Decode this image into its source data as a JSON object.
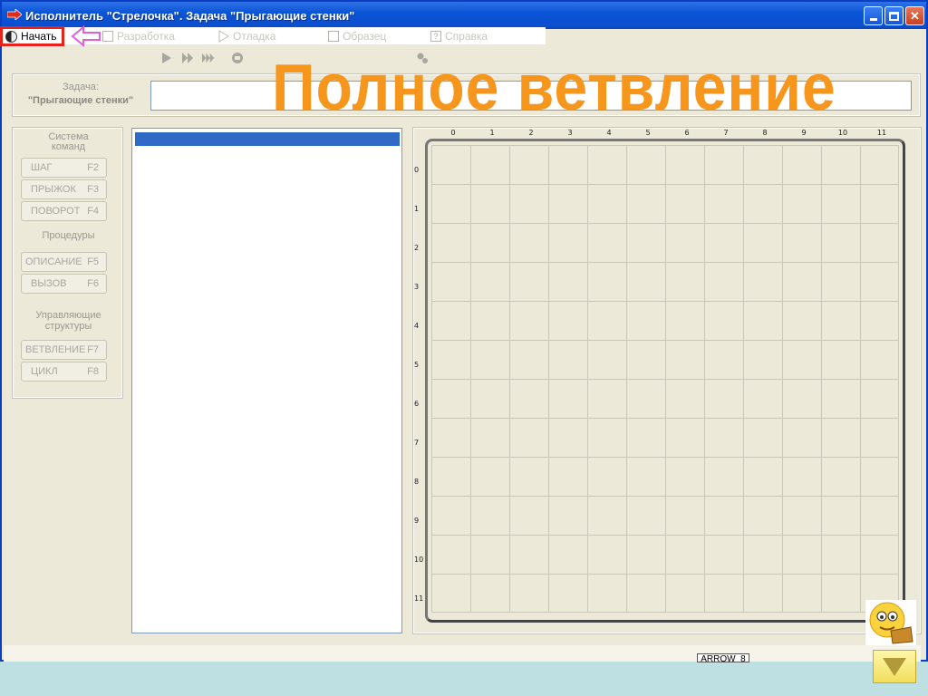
{
  "window": {
    "title": "Исполнитель \"Стрелочка\".  Задача  \"Прыгающие стенки\"",
    "controls": [
      "minimize",
      "maximize",
      "close"
    ]
  },
  "menu": {
    "start_label": "Начать",
    "items": [
      {
        "label": "Разработка",
        "icon": "document-icon"
      },
      {
        "label": "Отладка",
        "icon": "play-outline-icon"
      },
      {
        "label": "Образец",
        "icon": "sample-icon"
      },
      {
        "label": "Справка",
        "icon": "help-icon"
      }
    ]
  },
  "toolbar": {
    "icons": [
      "run-icon",
      "step-run-icon",
      "fast-run-icon",
      "stop-icon",
      "settings-icon"
    ]
  },
  "task": {
    "label": "Задача:",
    "name": "\"Прыгающие стенки\"",
    "field_value": ""
  },
  "overlay": {
    "heading": "Полное  ветвление"
  },
  "commands": {
    "system_title_line1": "Система",
    "system_title_line2": "команд",
    "system": [
      {
        "label": "ШАГ",
        "key": "F2"
      },
      {
        "label": "ПРЫЖОК",
        "key": "F3"
      },
      {
        "label": "ПОВОРОТ",
        "key": "F4"
      }
    ],
    "procedures_title": "Процедуры",
    "procedures": [
      {
        "label": "ОПИСАНИЕ",
        "key": "F5"
      },
      {
        "label": "ВЫЗОВ",
        "key": "F6"
      }
    ],
    "control_title_line1": "Управляющие",
    "control_title_line2": "структуры",
    "control": [
      {
        "label": "ВЕТВЛЕНИЕ",
        "key": "F7"
      },
      {
        "label": "ЦИКЛ",
        "key": "F8"
      }
    ]
  },
  "grid": {
    "columns": [
      "0",
      "1",
      "2",
      "3",
      "4",
      "5",
      "6",
      "7",
      "8",
      "9",
      "10",
      "11"
    ],
    "rows": [
      "0",
      "1",
      "2",
      "3",
      "4",
      "5",
      "6",
      "7",
      "8",
      "9",
      "10",
      "11"
    ]
  },
  "status": {
    "text": "ARROW_8"
  },
  "colors": {
    "titlebar": "#0a54d6",
    "overlay_heading": "#f7961c",
    "start_border": "#e6231a",
    "selection": "#316ac5"
  }
}
